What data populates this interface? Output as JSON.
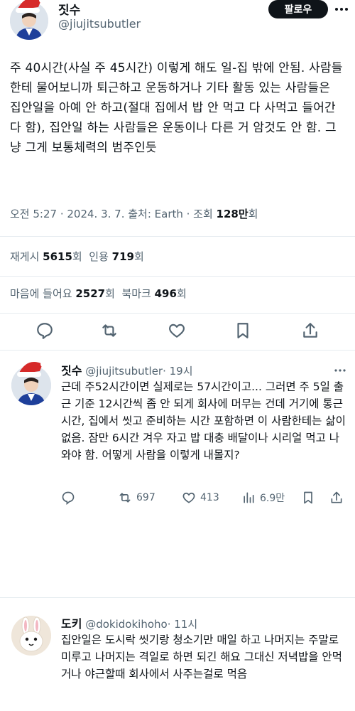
{
  "main_tweet": {
    "author_name": "짓수",
    "author_handle": "@jiujitsubutler",
    "follow_label": "팔로우",
    "text": "주 40시간(사실 주 45시간) 이렇게 해도 일-집 밖에 안됨. 사람들한테 물어보니까 퇴근하고 운동하거나 기타 활동 있는 사람들은 집안일을 아예 안 하고(절대 집에서 밥 안 먹고 다 사먹고 들어간다 함), 집안일 하는 사람들은 운동이나 다른 거 암것도 안 함. 그냥 그게 보통체력의 범주인듯",
    "meta_prefix": "오전 5:27 · 2024. 3. 7. 출처: Earth · 조회 ",
    "views": "128만",
    "views_suffix": "회",
    "retweets_label": "재게시 ",
    "retweets": "5615",
    "retweets_suffix": "회",
    "quotes_label": "  인용 ",
    "quotes": "719",
    "quotes_suffix": "회",
    "likes_label": "마음에 들어요 ",
    "likes": "2527",
    "likes_suffix": "회",
    "bookmarks_label": "  북마크 ",
    "bookmarks": "496",
    "bookmarks_suffix": "회"
  },
  "reply1": {
    "author_name": "짓수",
    "author_handle": "@jiujitsubutler",
    "time": "· 19시",
    "text": "근데 주52시간이면 실제로는 57시간이고... 그러면 주 5일 출근 기준 12시간씩 좀 안 되게 회사에 머무는 건데 거기에 통근 시간, 집에서 씻고 준비하는 시간 포함하면 이 사람한테는 삶이 없음. 잠만 6시간 겨우 자고 밥 대충 배달이나 시리얼 먹고 나와야 함. 어떻게 사람을 이렇게 내몰지?",
    "retweets": "697",
    "likes": "413",
    "views": "6.9만"
  },
  "reply2": {
    "author_name": "도키",
    "author_handle": "@dokidokihoho",
    "time": "· 11시",
    "text": "집안일은 도시락 씻기랑 청소기만 매일 하고 나머지는 주말로 미루고 나머지는 격일로 하면 되긴 해요 그대신 저녁밥을 안먹거나 야근할때 회사에서 사주는걸로 먹음"
  },
  "colors": {
    "text": "#0f1419",
    "secondary": "#536471",
    "divider": "#e6ecf0",
    "hat_red": "#d62a2a"
  }
}
